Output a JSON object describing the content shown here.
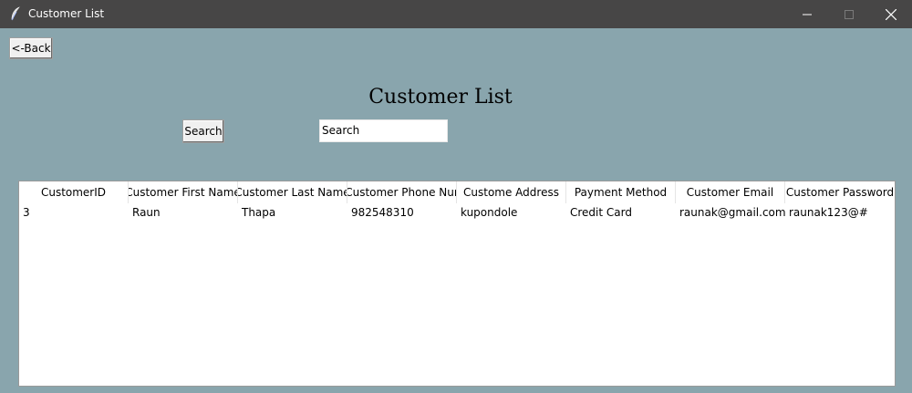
{
  "window": {
    "title": "Customer List",
    "icon": "feather-icon"
  },
  "toolbar": {
    "back_label": "<-Back"
  },
  "page": {
    "title": "Customer List"
  },
  "search": {
    "button_label": "Search",
    "input_value": "Search"
  },
  "table": {
    "columns": [
      "CustomerID",
      "Customer First Name",
      "Customer Last Name",
      "Customer Phone Nur",
      "Custome Address",
      "Payment Method",
      "Customer Email",
      "Customer Password"
    ],
    "rows": [
      [
        "3",
        "Raun",
        "Thapa",
        "982548310",
        "kupondole",
        "Credit Card",
        "raunak@gmail.com",
        "raunak123@#"
      ]
    ]
  },
  "colors": {
    "background": "#89a5ad",
    "titlebar": "#474646"
  }
}
